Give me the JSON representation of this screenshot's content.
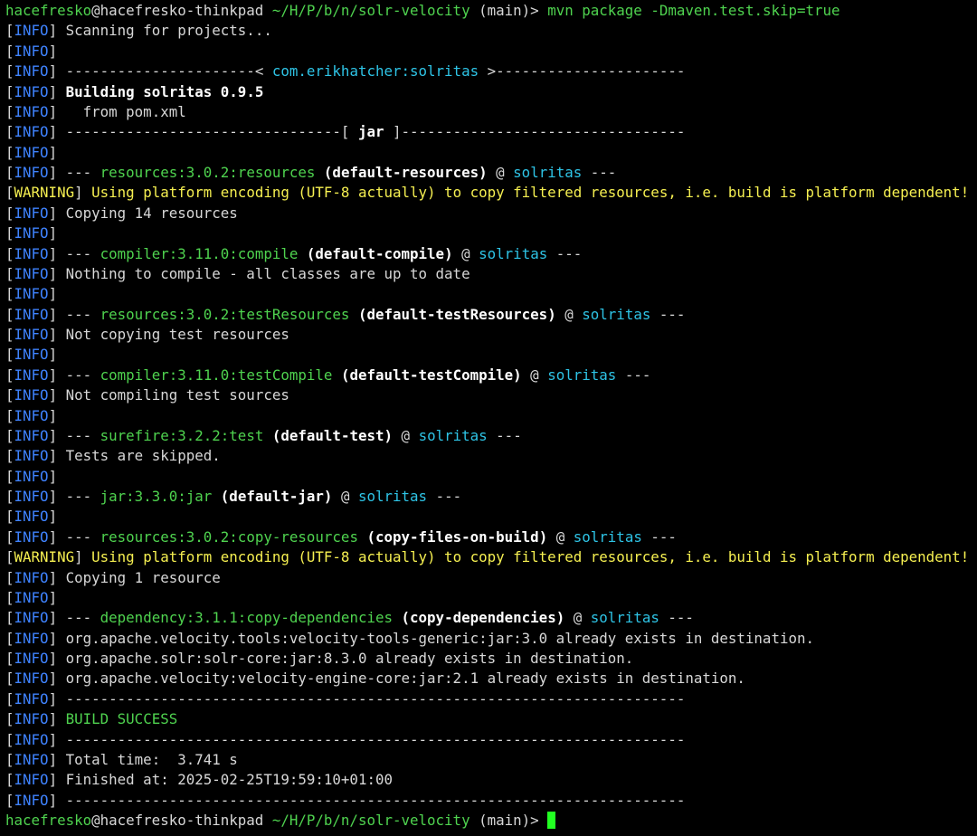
{
  "terminal": {
    "colors": {
      "background": "#000000",
      "text": "#d8d8d8",
      "green": "#4fd34f",
      "cyan": "#2ec4e6",
      "blue": "#3f83ff",
      "yellow": "#f6f051",
      "white": "#ffffff",
      "cursor": "#22ff22"
    },
    "lines": [
      [
        {
          "t": "hacefresko",
          "c": "green"
        },
        {
          "t": "@hacefresko-thinkpad",
          "c": "default"
        },
        {
          "t": " ~/H/P/b/n/solr-velocity",
          "c": "green"
        },
        {
          "t": " (main)> ",
          "c": "default"
        },
        {
          "t": "mvn package -Dmaven.test.skip=true",
          "c": "green"
        }
      ],
      [
        {
          "t": "[",
          "c": "default"
        },
        {
          "t": "INFO",
          "c": "blue"
        },
        {
          "t": "] Scanning for projects...",
          "c": "default"
        }
      ],
      [
        {
          "t": "[",
          "c": "default"
        },
        {
          "t": "INFO",
          "c": "blue"
        },
        {
          "t": "]",
          "c": "default"
        }
      ],
      [
        {
          "t": "[",
          "c": "default"
        },
        {
          "t": "INFO",
          "c": "blue"
        },
        {
          "t": "] ----------------------< ",
          "c": "default"
        },
        {
          "t": "com.erikhatcher:solritas",
          "c": "cyan"
        },
        {
          "t": " >----------------------",
          "c": "default"
        }
      ],
      [
        {
          "t": "[",
          "c": "default"
        },
        {
          "t": "INFO",
          "c": "blue"
        },
        {
          "t": "] ",
          "c": "default"
        },
        {
          "t": "Building solritas 0.9.5",
          "c": "white"
        }
      ],
      [
        {
          "t": "[",
          "c": "default"
        },
        {
          "t": "INFO",
          "c": "blue"
        },
        {
          "t": "]   from pom.xml",
          "c": "default"
        }
      ],
      [
        {
          "t": "[",
          "c": "default"
        },
        {
          "t": "INFO",
          "c": "blue"
        },
        {
          "t": "] --------------------------------[ ",
          "c": "default"
        },
        {
          "t": "jar",
          "c": "white"
        },
        {
          "t": " ]---------------------------------",
          "c": "default"
        }
      ],
      [
        {
          "t": "[",
          "c": "default"
        },
        {
          "t": "INFO",
          "c": "blue"
        },
        {
          "t": "]",
          "c": "default"
        }
      ],
      [
        {
          "t": "[",
          "c": "default"
        },
        {
          "t": "INFO",
          "c": "blue"
        },
        {
          "t": "] --- ",
          "c": "default"
        },
        {
          "t": "resources:3.0.2:resources",
          "c": "green"
        },
        {
          "t": " (default-resources)",
          "c": "white"
        },
        {
          "t": " @ ",
          "c": "default"
        },
        {
          "t": "solritas",
          "c": "cyan"
        },
        {
          "t": " ---",
          "c": "default"
        }
      ],
      [
        {
          "t": "[",
          "c": "default"
        },
        {
          "t": "WARNING",
          "c": "yellow"
        },
        {
          "t": "] ",
          "c": "default"
        },
        {
          "t": "Using platform encoding (UTF-8 actually) to copy filtered resources, i.e. build is platform dependent!",
          "c": "yellow"
        }
      ],
      [
        {
          "t": "[",
          "c": "default"
        },
        {
          "t": "INFO",
          "c": "blue"
        },
        {
          "t": "] Copying 14 resources",
          "c": "default"
        }
      ],
      [
        {
          "t": "[",
          "c": "default"
        },
        {
          "t": "INFO",
          "c": "blue"
        },
        {
          "t": "]",
          "c": "default"
        }
      ],
      [
        {
          "t": "[",
          "c": "default"
        },
        {
          "t": "INFO",
          "c": "blue"
        },
        {
          "t": "] --- ",
          "c": "default"
        },
        {
          "t": "compiler:3.11.0:compile",
          "c": "green"
        },
        {
          "t": " (default-compile)",
          "c": "white"
        },
        {
          "t": " @ ",
          "c": "default"
        },
        {
          "t": "solritas",
          "c": "cyan"
        },
        {
          "t": " ---",
          "c": "default"
        }
      ],
      [
        {
          "t": "[",
          "c": "default"
        },
        {
          "t": "INFO",
          "c": "blue"
        },
        {
          "t": "] Nothing to compile - all classes are up to date",
          "c": "default"
        }
      ],
      [
        {
          "t": "[",
          "c": "default"
        },
        {
          "t": "INFO",
          "c": "blue"
        },
        {
          "t": "]",
          "c": "default"
        }
      ],
      [
        {
          "t": "[",
          "c": "default"
        },
        {
          "t": "INFO",
          "c": "blue"
        },
        {
          "t": "] --- ",
          "c": "default"
        },
        {
          "t": "resources:3.0.2:testResources",
          "c": "green"
        },
        {
          "t": " (default-testResources)",
          "c": "white"
        },
        {
          "t": " @ ",
          "c": "default"
        },
        {
          "t": "solritas",
          "c": "cyan"
        },
        {
          "t": " ---",
          "c": "default"
        }
      ],
      [
        {
          "t": "[",
          "c": "default"
        },
        {
          "t": "INFO",
          "c": "blue"
        },
        {
          "t": "] Not copying test resources",
          "c": "default"
        }
      ],
      [
        {
          "t": "[",
          "c": "default"
        },
        {
          "t": "INFO",
          "c": "blue"
        },
        {
          "t": "]",
          "c": "default"
        }
      ],
      [
        {
          "t": "[",
          "c": "default"
        },
        {
          "t": "INFO",
          "c": "blue"
        },
        {
          "t": "] --- ",
          "c": "default"
        },
        {
          "t": "compiler:3.11.0:testCompile",
          "c": "green"
        },
        {
          "t": " (default-testCompile)",
          "c": "white"
        },
        {
          "t": " @ ",
          "c": "default"
        },
        {
          "t": "solritas",
          "c": "cyan"
        },
        {
          "t": " ---",
          "c": "default"
        }
      ],
      [
        {
          "t": "[",
          "c": "default"
        },
        {
          "t": "INFO",
          "c": "blue"
        },
        {
          "t": "] Not compiling test sources",
          "c": "default"
        }
      ],
      [
        {
          "t": "[",
          "c": "default"
        },
        {
          "t": "INFO",
          "c": "blue"
        },
        {
          "t": "]",
          "c": "default"
        }
      ],
      [
        {
          "t": "[",
          "c": "default"
        },
        {
          "t": "INFO",
          "c": "blue"
        },
        {
          "t": "] --- ",
          "c": "default"
        },
        {
          "t": "surefire:3.2.2:test",
          "c": "green"
        },
        {
          "t": " (default-test)",
          "c": "white"
        },
        {
          "t": " @ ",
          "c": "default"
        },
        {
          "t": "solritas",
          "c": "cyan"
        },
        {
          "t": " ---",
          "c": "default"
        }
      ],
      [
        {
          "t": "[",
          "c": "default"
        },
        {
          "t": "INFO",
          "c": "blue"
        },
        {
          "t": "] Tests are skipped.",
          "c": "default"
        }
      ],
      [
        {
          "t": "[",
          "c": "default"
        },
        {
          "t": "INFO",
          "c": "blue"
        },
        {
          "t": "]",
          "c": "default"
        }
      ],
      [
        {
          "t": "[",
          "c": "default"
        },
        {
          "t": "INFO",
          "c": "blue"
        },
        {
          "t": "] --- ",
          "c": "default"
        },
        {
          "t": "jar:3.3.0:jar",
          "c": "green"
        },
        {
          "t": " (default-jar)",
          "c": "white"
        },
        {
          "t": " @ ",
          "c": "default"
        },
        {
          "t": "solritas",
          "c": "cyan"
        },
        {
          "t": " ---",
          "c": "default"
        }
      ],
      [
        {
          "t": "[",
          "c": "default"
        },
        {
          "t": "INFO",
          "c": "blue"
        },
        {
          "t": "]",
          "c": "default"
        }
      ],
      [
        {
          "t": "[",
          "c": "default"
        },
        {
          "t": "INFO",
          "c": "blue"
        },
        {
          "t": "] --- ",
          "c": "default"
        },
        {
          "t": "resources:3.0.2:copy-resources",
          "c": "green"
        },
        {
          "t": " (copy-files-on-build)",
          "c": "white"
        },
        {
          "t": " @ ",
          "c": "default"
        },
        {
          "t": "solritas",
          "c": "cyan"
        },
        {
          "t": " ---",
          "c": "default"
        }
      ],
      [
        {
          "t": "[",
          "c": "default"
        },
        {
          "t": "WARNING",
          "c": "yellow"
        },
        {
          "t": "] ",
          "c": "default"
        },
        {
          "t": "Using platform encoding (UTF-8 actually) to copy filtered resources, i.e. build is platform dependent!",
          "c": "yellow"
        }
      ],
      [
        {
          "t": "[",
          "c": "default"
        },
        {
          "t": "INFO",
          "c": "blue"
        },
        {
          "t": "] Copying 1 resource",
          "c": "default"
        }
      ],
      [
        {
          "t": "[",
          "c": "default"
        },
        {
          "t": "INFO",
          "c": "blue"
        },
        {
          "t": "]",
          "c": "default"
        }
      ],
      [
        {
          "t": "[",
          "c": "default"
        },
        {
          "t": "INFO",
          "c": "blue"
        },
        {
          "t": "] --- ",
          "c": "default"
        },
        {
          "t": "dependency:3.1.1:copy-dependencies",
          "c": "green"
        },
        {
          "t": " (copy-dependencies)",
          "c": "white"
        },
        {
          "t": " @ ",
          "c": "default"
        },
        {
          "t": "solritas",
          "c": "cyan"
        },
        {
          "t": " ---",
          "c": "default"
        }
      ],
      [
        {
          "t": "[",
          "c": "default"
        },
        {
          "t": "INFO",
          "c": "blue"
        },
        {
          "t": "] org.apache.velocity.tools:velocity-tools-generic:jar:3.0 already exists in destination.",
          "c": "default"
        }
      ],
      [
        {
          "t": "[",
          "c": "default"
        },
        {
          "t": "INFO",
          "c": "blue"
        },
        {
          "t": "] org.apache.solr:solr-core:jar:8.3.0 already exists in destination.",
          "c": "default"
        }
      ],
      [
        {
          "t": "[",
          "c": "default"
        },
        {
          "t": "INFO",
          "c": "blue"
        },
        {
          "t": "] org.apache.velocity:velocity-engine-core:jar:2.1 already exists in destination.",
          "c": "default"
        }
      ],
      [
        {
          "t": "[",
          "c": "default"
        },
        {
          "t": "INFO",
          "c": "blue"
        },
        {
          "t": "] ------------------------------------------------------------------------",
          "c": "default"
        }
      ],
      [
        {
          "t": "[",
          "c": "default"
        },
        {
          "t": "INFO",
          "c": "blue"
        },
        {
          "t": "] ",
          "c": "default"
        },
        {
          "t": "BUILD SUCCESS",
          "c": "green"
        }
      ],
      [
        {
          "t": "[",
          "c": "default"
        },
        {
          "t": "INFO",
          "c": "blue"
        },
        {
          "t": "] ------------------------------------------------------------------------",
          "c": "default"
        }
      ],
      [
        {
          "t": "[",
          "c": "default"
        },
        {
          "t": "INFO",
          "c": "blue"
        },
        {
          "t": "] Total time:  3.741 s",
          "c": "default"
        }
      ],
      [
        {
          "t": "[",
          "c": "default"
        },
        {
          "t": "INFO",
          "c": "blue"
        },
        {
          "t": "] Finished at: 2025-02-25T19:59:10+01:00",
          "c": "default"
        }
      ],
      [
        {
          "t": "[",
          "c": "default"
        },
        {
          "t": "INFO",
          "c": "blue"
        },
        {
          "t": "] ------------------------------------------------------------------------",
          "c": "default"
        }
      ],
      [
        {
          "t": "hacefresko",
          "c": "green"
        },
        {
          "t": "@hacefresko-thinkpad",
          "c": "default"
        },
        {
          "t": " ~/H/P/b/n/solr-velocity",
          "c": "green"
        },
        {
          "t": " (main)> ",
          "c": "default"
        }
      ]
    ],
    "cursor_line": 40
  }
}
